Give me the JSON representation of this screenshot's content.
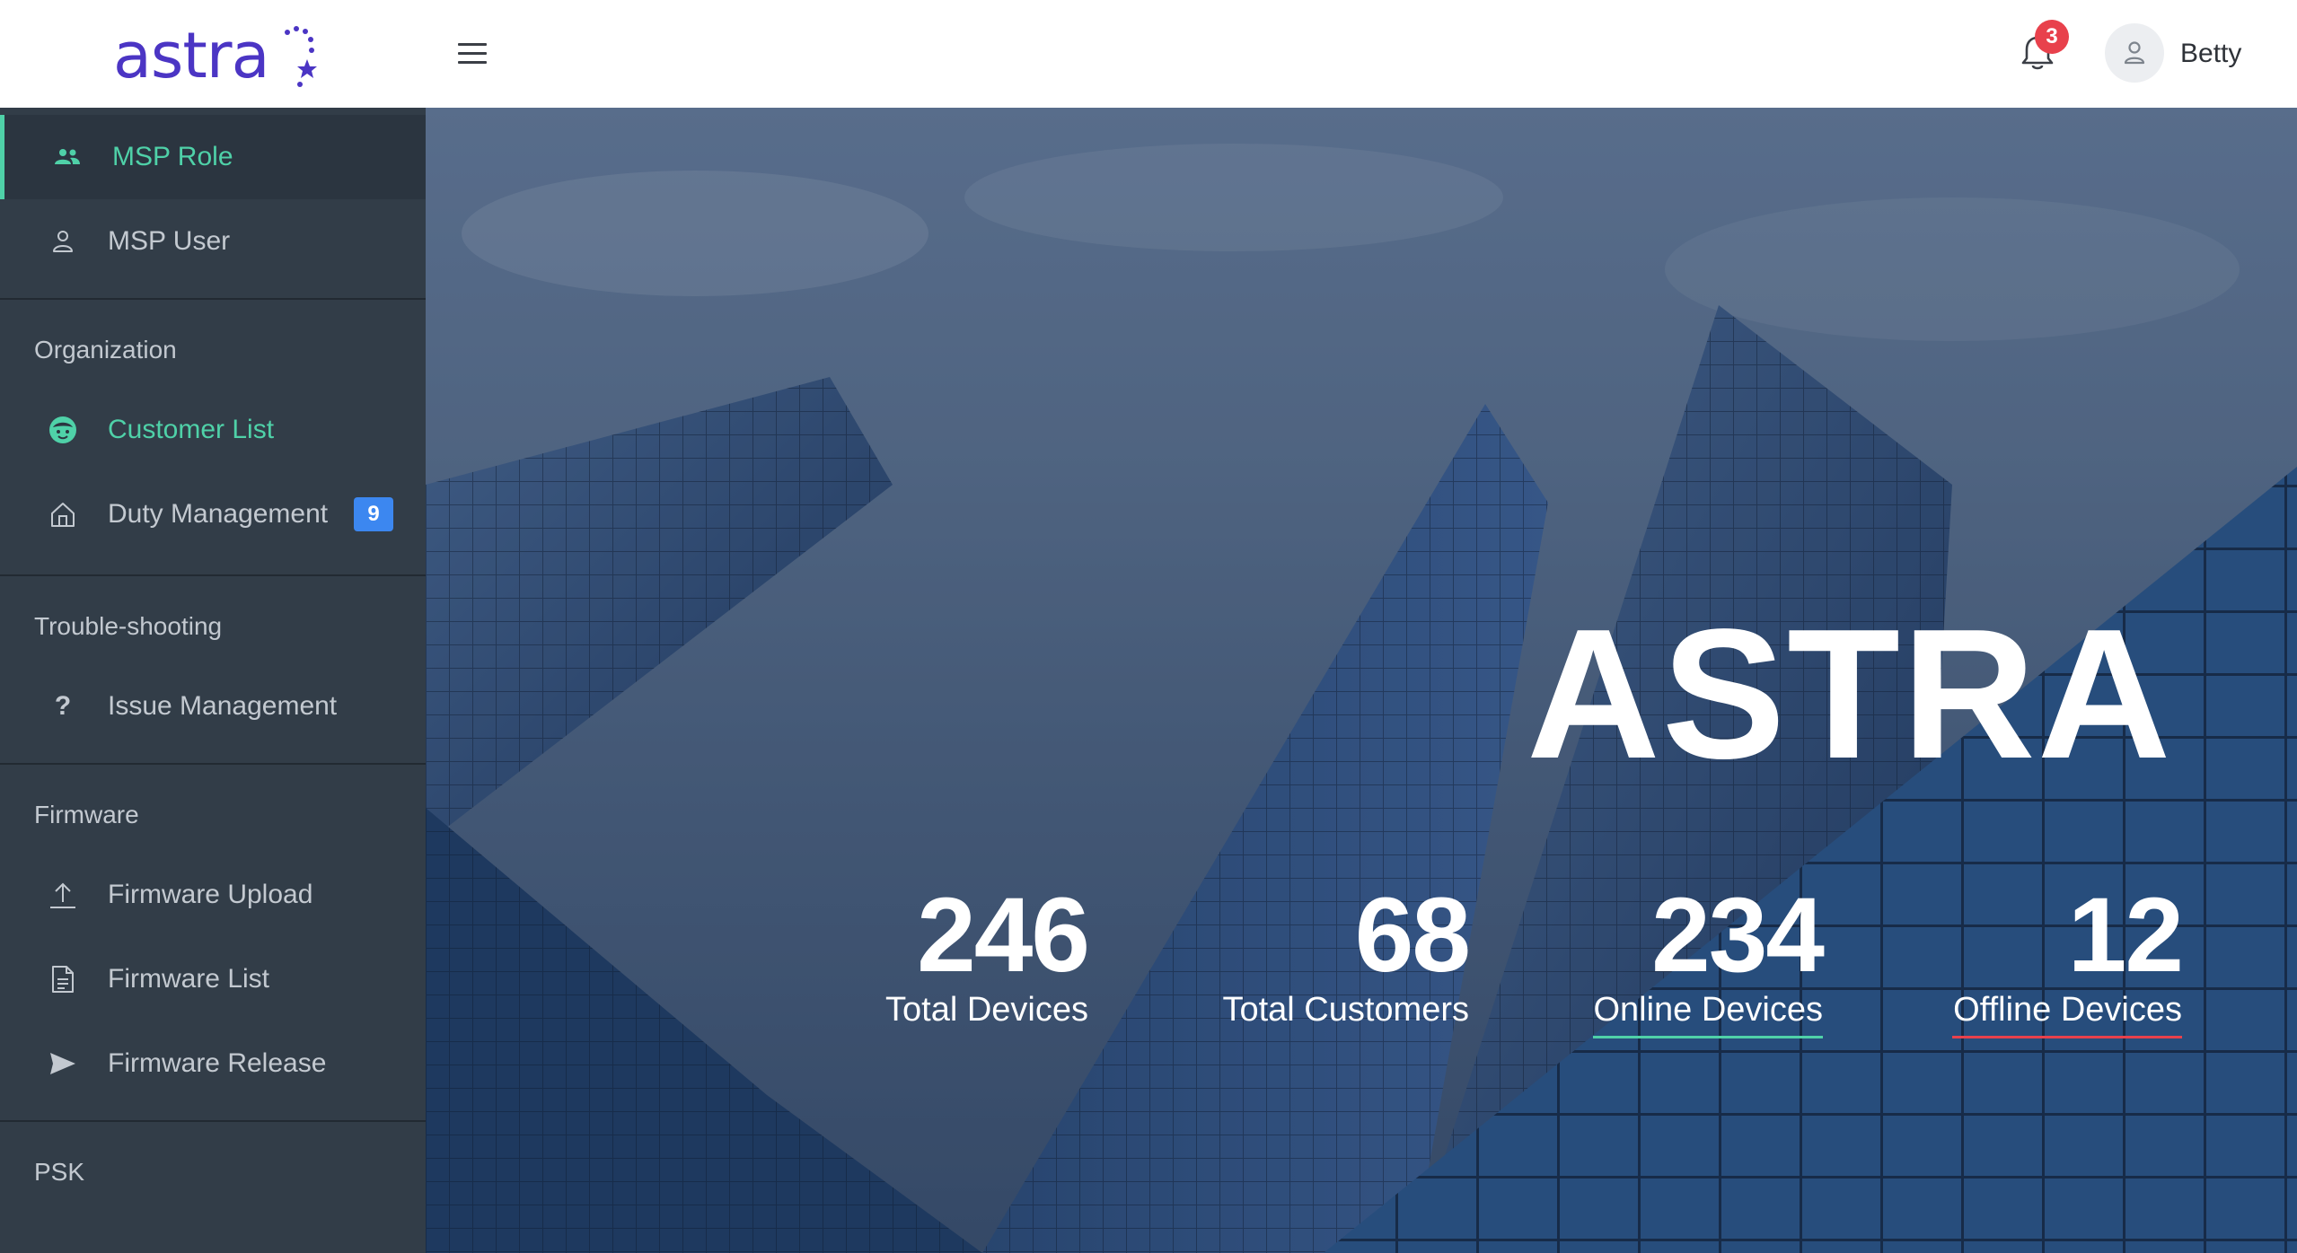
{
  "header": {
    "logo_text": "astra",
    "notifications_count": "3",
    "user_name": "Betty"
  },
  "sidebar": {
    "items": [
      {
        "label": "MSP Role",
        "icon": "group-icon",
        "active": true
      },
      {
        "label": "MSP User",
        "icon": "user-icon"
      }
    ],
    "sections": [
      {
        "title": "Organization",
        "items": [
          {
            "label": "Customer List",
            "icon": "customer-face-icon"
          },
          {
            "label": "Duty Management",
            "icon": "home-icon",
            "badge": "9"
          }
        ]
      },
      {
        "title": "Trouble-shooting",
        "items": [
          {
            "label": "Issue Management",
            "icon": "question-icon"
          }
        ]
      },
      {
        "title": "Firmware",
        "items": [
          {
            "label": "Firmware Upload",
            "icon": "upload-icon"
          },
          {
            "label": "Firmware List",
            "icon": "document-icon"
          },
          {
            "label": "Firmware Release",
            "icon": "send-icon"
          }
        ]
      },
      {
        "title": "PSK",
        "items": []
      }
    ]
  },
  "hero": {
    "title": "ASTRA",
    "stats": [
      {
        "value": "246",
        "label": "Total Devices"
      },
      {
        "value": "68",
        "label": "Total Customers"
      },
      {
        "value": "234",
        "label": "Online Devices",
        "underline_color": "#4fd1a8"
      },
      {
        "value": "12",
        "label": "Offline Devices",
        "underline_color": "#e8414c"
      }
    ]
  },
  "colors": {
    "accent_teal": "#4fd1a8",
    "brand_purple": "#4b35c4",
    "sidebar_bg": "#323d48",
    "badge_blue": "#3c87f0",
    "alert_red": "#e8414c"
  }
}
